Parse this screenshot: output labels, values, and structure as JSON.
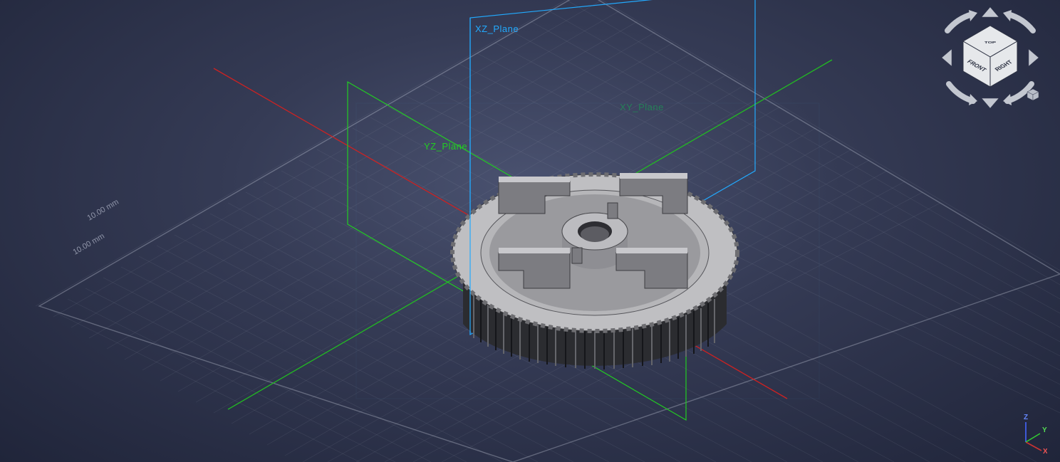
{
  "planes": {
    "xz_label": "XZ_Plane",
    "yz_label": "YZ_Plane",
    "xy_label": "XY_Plane"
  },
  "grid": {
    "label_a": "10.00 mm",
    "label_b": "10.00 mm"
  },
  "navcube": {
    "face_top": "TOP",
    "face_front": "FRONT",
    "face_right": "RIGHT"
  },
  "axis_triad": {
    "x": "X",
    "y": "Y",
    "z": "Z"
  },
  "colors": {
    "axis_x": "#d33",
    "axis_y": "#3c3",
    "axis_z": "#55f",
    "plane_xz": "#0af",
    "plane_yz": "#0f0",
    "grid_major": "rgba(180,185,200,0.25)",
    "grid_minor": "rgba(180,185,200,0.08)"
  }
}
